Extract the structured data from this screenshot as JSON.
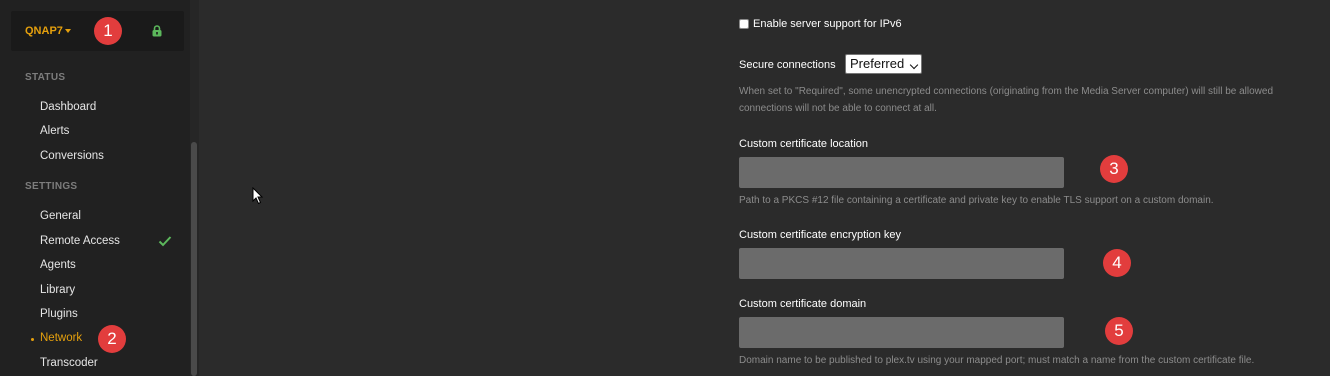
{
  "sidebar": {
    "server_name": "QNAP7",
    "status_label": "STATUS",
    "status_items": [
      "Dashboard",
      "Alerts",
      "Conversions"
    ],
    "settings_label": "SETTINGS",
    "settings_items": [
      "General",
      "Remote Access",
      "Agents",
      "Library",
      "Plugins",
      "Network",
      "Transcoder"
    ],
    "active_item": "Network"
  },
  "main": {
    "ipv6_label": "Enable server support for IPv6",
    "ipv6_checked": false,
    "secure_connections_label": "Secure connections",
    "secure_connections_value": "Preferred",
    "secure_connections_help_line1": "When set to \"Required\", some unencrypted connections (originating from the Media Server computer) will still be allowed",
    "secure_connections_help_line2": "connections will not be able to connect at all.",
    "cert_location_label": "Custom certificate location",
    "cert_location_value": "",
    "cert_location_help": "Path to a PKCS #12 file containing a certificate and private key to enable TLS support on a custom domain.",
    "cert_key_label": "Custom certificate encryption key",
    "cert_key_value": "",
    "cert_domain_label": "Custom certificate domain",
    "cert_domain_value": "",
    "cert_domain_help": "Domain name to be published to plex.tv using your mapped port; must match a name from the custom certificate file."
  },
  "annotations": [
    "1",
    "2",
    "3",
    "4",
    "5"
  ],
  "colors": {
    "accent": "#e5a00d",
    "badge": "#e23d3d",
    "check": "#5cb85c",
    "background": "#2b2b2b",
    "sidebar": "#212121"
  }
}
